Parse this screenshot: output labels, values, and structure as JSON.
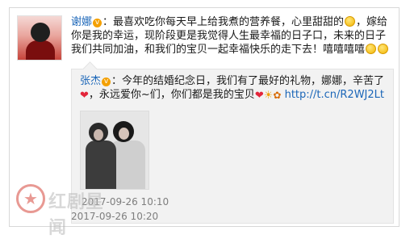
{
  "post": {
    "author": "谢娜",
    "vbadge": "v",
    "colon": "：",
    "text_part1": "最喜欢吃你每天早上给我煮的营养餐，心里甜甜的",
    "text_part2": "，嫁给你是我的幸运，现阶段更是我觉得人生最幸福的日子口，未来的日子我们共同加油，和我们的宝贝一起幸福快乐的走下去！嘻嘻嘻嘻",
    "date": "2017-09-26 10:20",
    "icons": [
      "avatar",
      "smile-emoji",
      "grin-emoji"
    ]
  },
  "retweet": {
    "author": "张杰",
    "vbadge": "v",
    "colon": "：",
    "text_part1": "今年的结婚纪念日，我们有了最好的礼物，娜娜，辛苦了",
    "text_part2": "，永远爱你~们，你们都是我的宝贝",
    "link": "http://t.cn/R2WJ2Lt",
    "date": "2017-09-26 10:10",
    "icons": [
      "heart-emoji",
      "sun-emoji",
      "gift-emoji"
    ]
  },
  "watermark": {
    "text": "红剧星闻"
  },
  "colors": {
    "name": "#1b66b8",
    "link": "#1b66b8",
    "date": "#7e7e7e",
    "retweet_bg": "#f2f2f2"
  }
}
